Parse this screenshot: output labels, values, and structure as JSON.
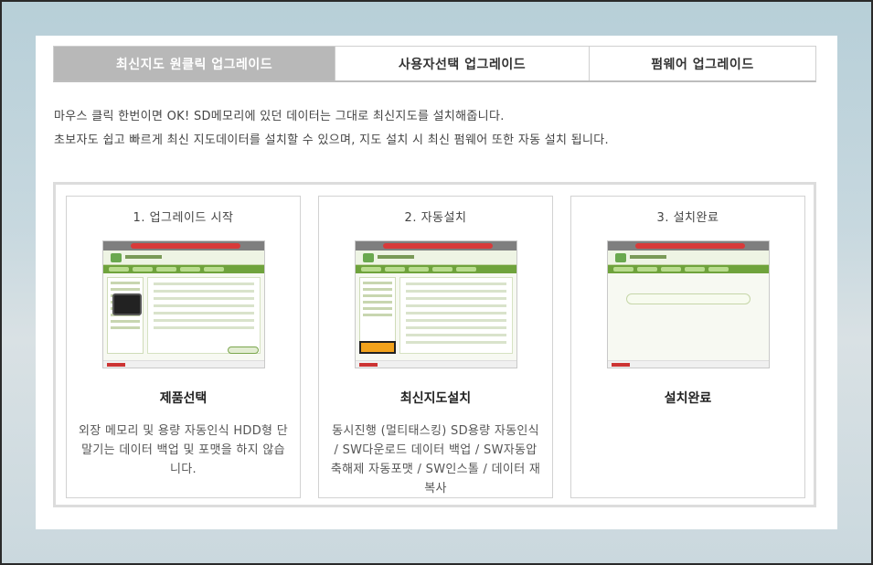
{
  "tabs": [
    {
      "label": "최신지도 원클릭 업그레이드",
      "active": true
    },
    {
      "label": "사용자선택 업그레이드",
      "active": false
    },
    {
      "label": "펌웨어 업그레이드",
      "active": false
    }
  ],
  "intro": {
    "line1": "마우스 클릭 한번이면 OK! SD메모리에 있던 데이터는 그대로 최신지도를 설치해줍니다.",
    "line2": "초보자도 쉽고 빠르게 최신 지도데이터를 설치할 수 있으며, 지도 설치 시 최신 펌웨어 또한 자동 설치 됩니다."
  },
  "steps": [
    {
      "title": "1. 업그레이드 시작",
      "name": "제품선택",
      "desc": "외장 메모리 및 용량 자동인식 HDD형 단말기는 데이터 백업 및 포맷을 하지 않습니다."
    },
    {
      "title": "2. 자동설치",
      "name": "최신지도설치",
      "desc": "동시진행 (멀티태스킹) SD용량 자동인식 / SW다운로드 데이터 백업 / SW자동압축해제 자동포맷 / SW인스톨 / 데이터 재복사"
    },
    {
      "title": "3. 설치완료",
      "name": "설치완료",
      "desc": ""
    }
  ],
  "colors": {
    "active_tab": "#b8b8b8",
    "thumb_green": "#6fa33c",
    "thumb_red": "#d83a3a"
  }
}
